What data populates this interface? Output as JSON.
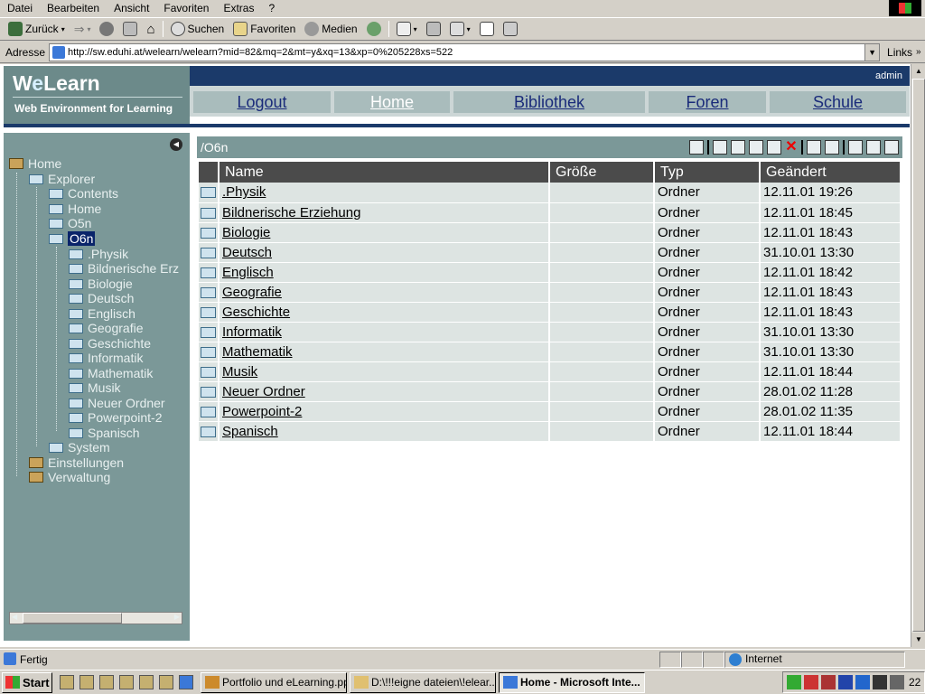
{
  "menu": [
    "Datei",
    "Bearbeiten",
    "Ansicht",
    "Favoriten",
    "Extras",
    "?"
  ],
  "toolbar": {
    "back": "Zurück",
    "search": "Suchen",
    "favorites": "Favoriten",
    "media": "Medien"
  },
  "address": {
    "label": "Adresse",
    "url": "http://sw.eduhi.at/welearn/welearn?mid=82&mq=2&mt=y&xq=13&xp=0%205228xs=522",
    "links": "Links"
  },
  "logo": {
    "title_w": "W",
    "title_e": "e",
    "title_rest": "Learn",
    "subtitle": "Web Environment for Learning"
  },
  "header": {
    "user": "admin"
  },
  "nav": [
    "Logout",
    "Home",
    "Bibliothek",
    "Foren",
    "Schule"
  ],
  "tree": {
    "home": "Home",
    "explorer": "Explorer",
    "contents": "Contents",
    "home2": "Home",
    "o5n": "O5n",
    "o6n": "O6n",
    "children": [
      ".Physik",
      "Bildnerische Erz",
      "Biologie",
      "Deutsch",
      "Englisch",
      "Geografie",
      "Geschichte",
      "Informatik",
      "Mathematik",
      "Musik",
      "Neuer Ordner",
      "Powerpoint-2",
      "Spanisch"
    ],
    "system": "System",
    "settings": "Einstellungen",
    "admin": "Verwaltung"
  },
  "main": {
    "path": "/O6n",
    "columns": [
      "Name",
      "Größe",
      "Typ",
      "Geändert"
    ],
    "rows": [
      {
        "name": ".Physik",
        "size": "",
        "type": "Ordner",
        "modified": "12.11.01 19:26"
      },
      {
        "name": "Bildnerische Erziehung",
        "size": "",
        "type": "Ordner",
        "modified": "12.11.01 18:45"
      },
      {
        "name": "Biologie",
        "size": "",
        "type": "Ordner",
        "modified": "12.11.01 18:43"
      },
      {
        "name": "Deutsch",
        "size": "",
        "type": "Ordner",
        "modified": "31.10.01 13:30"
      },
      {
        "name": "Englisch",
        "size": "",
        "type": "Ordner",
        "modified": "12.11.01 18:42"
      },
      {
        "name": "Geografie",
        "size": "",
        "type": "Ordner",
        "modified": "12.11.01 18:43"
      },
      {
        "name": "Geschichte",
        "size": "",
        "type": "Ordner",
        "modified": "12.11.01 18:43"
      },
      {
        "name": "Informatik",
        "size": "",
        "type": "Ordner",
        "modified": "31.10.01 13:30"
      },
      {
        "name": "Mathematik",
        "size": "",
        "type": "Ordner",
        "modified": "31.10.01 13:30"
      },
      {
        "name": "Musik",
        "size": "",
        "type": "Ordner",
        "modified": "12.11.01 18:44"
      },
      {
        "name": "Neuer Ordner",
        "size": "",
        "type": "Ordner",
        "modified": "28.01.02 11:28"
      },
      {
        "name": "Powerpoint-2",
        "size": "",
        "type": "Ordner",
        "modified": "28.01.02 11:35"
      },
      {
        "name": "Spanisch",
        "size": "",
        "type": "Ordner",
        "modified": "12.11.01 18:44"
      }
    ]
  },
  "status": {
    "text": "Fertig",
    "zone": "Internet"
  },
  "taskbar": {
    "start": "Start",
    "tasks": [
      "Portfolio und eLearning.ppt",
      "D:\\!!!eigne dateien\\!elear...",
      "Home - Microsoft Inte..."
    ],
    "clock": "22"
  },
  "colors": {
    "brand_dark": "#1b3a6a",
    "sidebar": "#7b9898",
    "header_row": "#4b4b4b",
    "row_bg": "#dde4e2"
  }
}
